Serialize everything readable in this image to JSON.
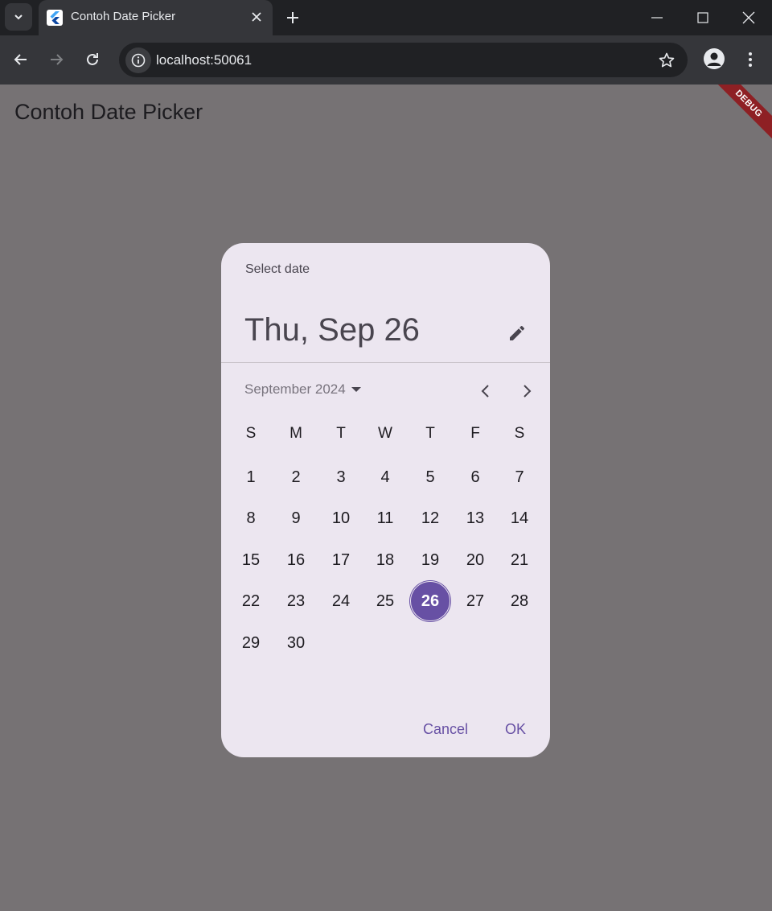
{
  "browser": {
    "tab_title": "Contoh Date Picker",
    "url": "localhost:50061"
  },
  "app": {
    "title": "Contoh Date Picker",
    "debug_banner": "DEBUG"
  },
  "dialog": {
    "help_text": "Select date",
    "headline": "Thu, Sep 26",
    "month_label": "September 2024",
    "weekdays": [
      "S",
      "M",
      "T",
      "W",
      "T",
      "F",
      "S"
    ],
    "days": [
      "1",
      "2",
      "3",
      "4",
      "5",
      "6",
      "7",
      "8",
      "9",
      "10",
      "11",
      "12",
      "13",
      "14",
      "15",
      "16",
      "17",
      "18",
      "19",
      "20",
      "21",
      "22",
      "23",
      "24",
      "25",
      "26",
      "27",
      "28",
      "29",
      "30"
    ],
    "first_weekday_index": 0,
    "selected_day": "26",
    "cancel_label": "Cancel",
    "ok_label": "OK"
  },
  "colors": {
    "accent": "#6750a4",
    "scrim": "#767274",
    "dialog_surface": "#ece6f0"
  }
}
